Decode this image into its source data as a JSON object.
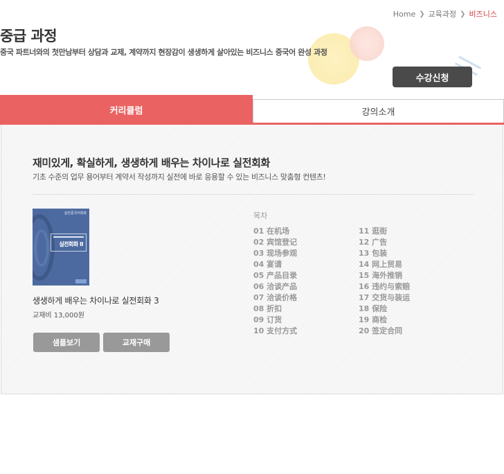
{
  "breadcrumb": {
    "home": "Home",
    "level2": "교육과정",
    "current": "비즈니스"
  },
  "header": {
    "title": "중급 과정",
    "subtitle": "중국 파트너와의 첫만남부터 상담과 교제, 계약까지 현장감이 생생하게 살아있는 비즈니스 중국어 완성 과정",
    "enroll_label": "수강신청"
  },
  "tabs": [
    {
      "label": "커리큘럼",
      "active": true
    },
    {
      "label": "강의소개",
      "active": false
    }
  ],
  "panel": {
    "heading": "재미있게, 확실하게, 생생하게 배우는 차이나로 실전회화",
    "description": "기초 수준의 업무 용어부터 계약서 작성까지 실전에 바로 응용할 수 있는 비즈니스 맞춤형 컨텐츠!"
  },
  "book": {
    "cover_top_text": "실전중국어회화",
    "cover_title": "실전회화 II",
    "title": "생생하게 배우는 차이나로 실전회화 3",
    "price": "교재비 13,000원",
    "sample_label": "샘플보기",
    "buy_label": "교재구매"
  },
  "toc": {
    "title": "목차",
    "items": [
      "01 在机场",
      "02 宾馆登记",
      "03 现场参观",
      "04 宴请",
      "05 产品目录",
      "06 洽谈产品",
      "07 洽谈价格",
      "08 折扣",
      "09 订货",
      "10 支付方式",
      "11 逛街",
      "12 广告",
      "13 包装",
      "14 网上贸易",
      "15 海外推销",
      "16 违约与索赔",
      "17 交货与装运",
      "18 保险",
      "19 商检",
      "20 签定合同"
    ]
  },
  "colors": {
    "accent": "#eb6262",
    "breadcrumb_current": "#d0393e",
    "dark_button": "#4a4a4a",
    "gray_button": "#999999"
  }
}
